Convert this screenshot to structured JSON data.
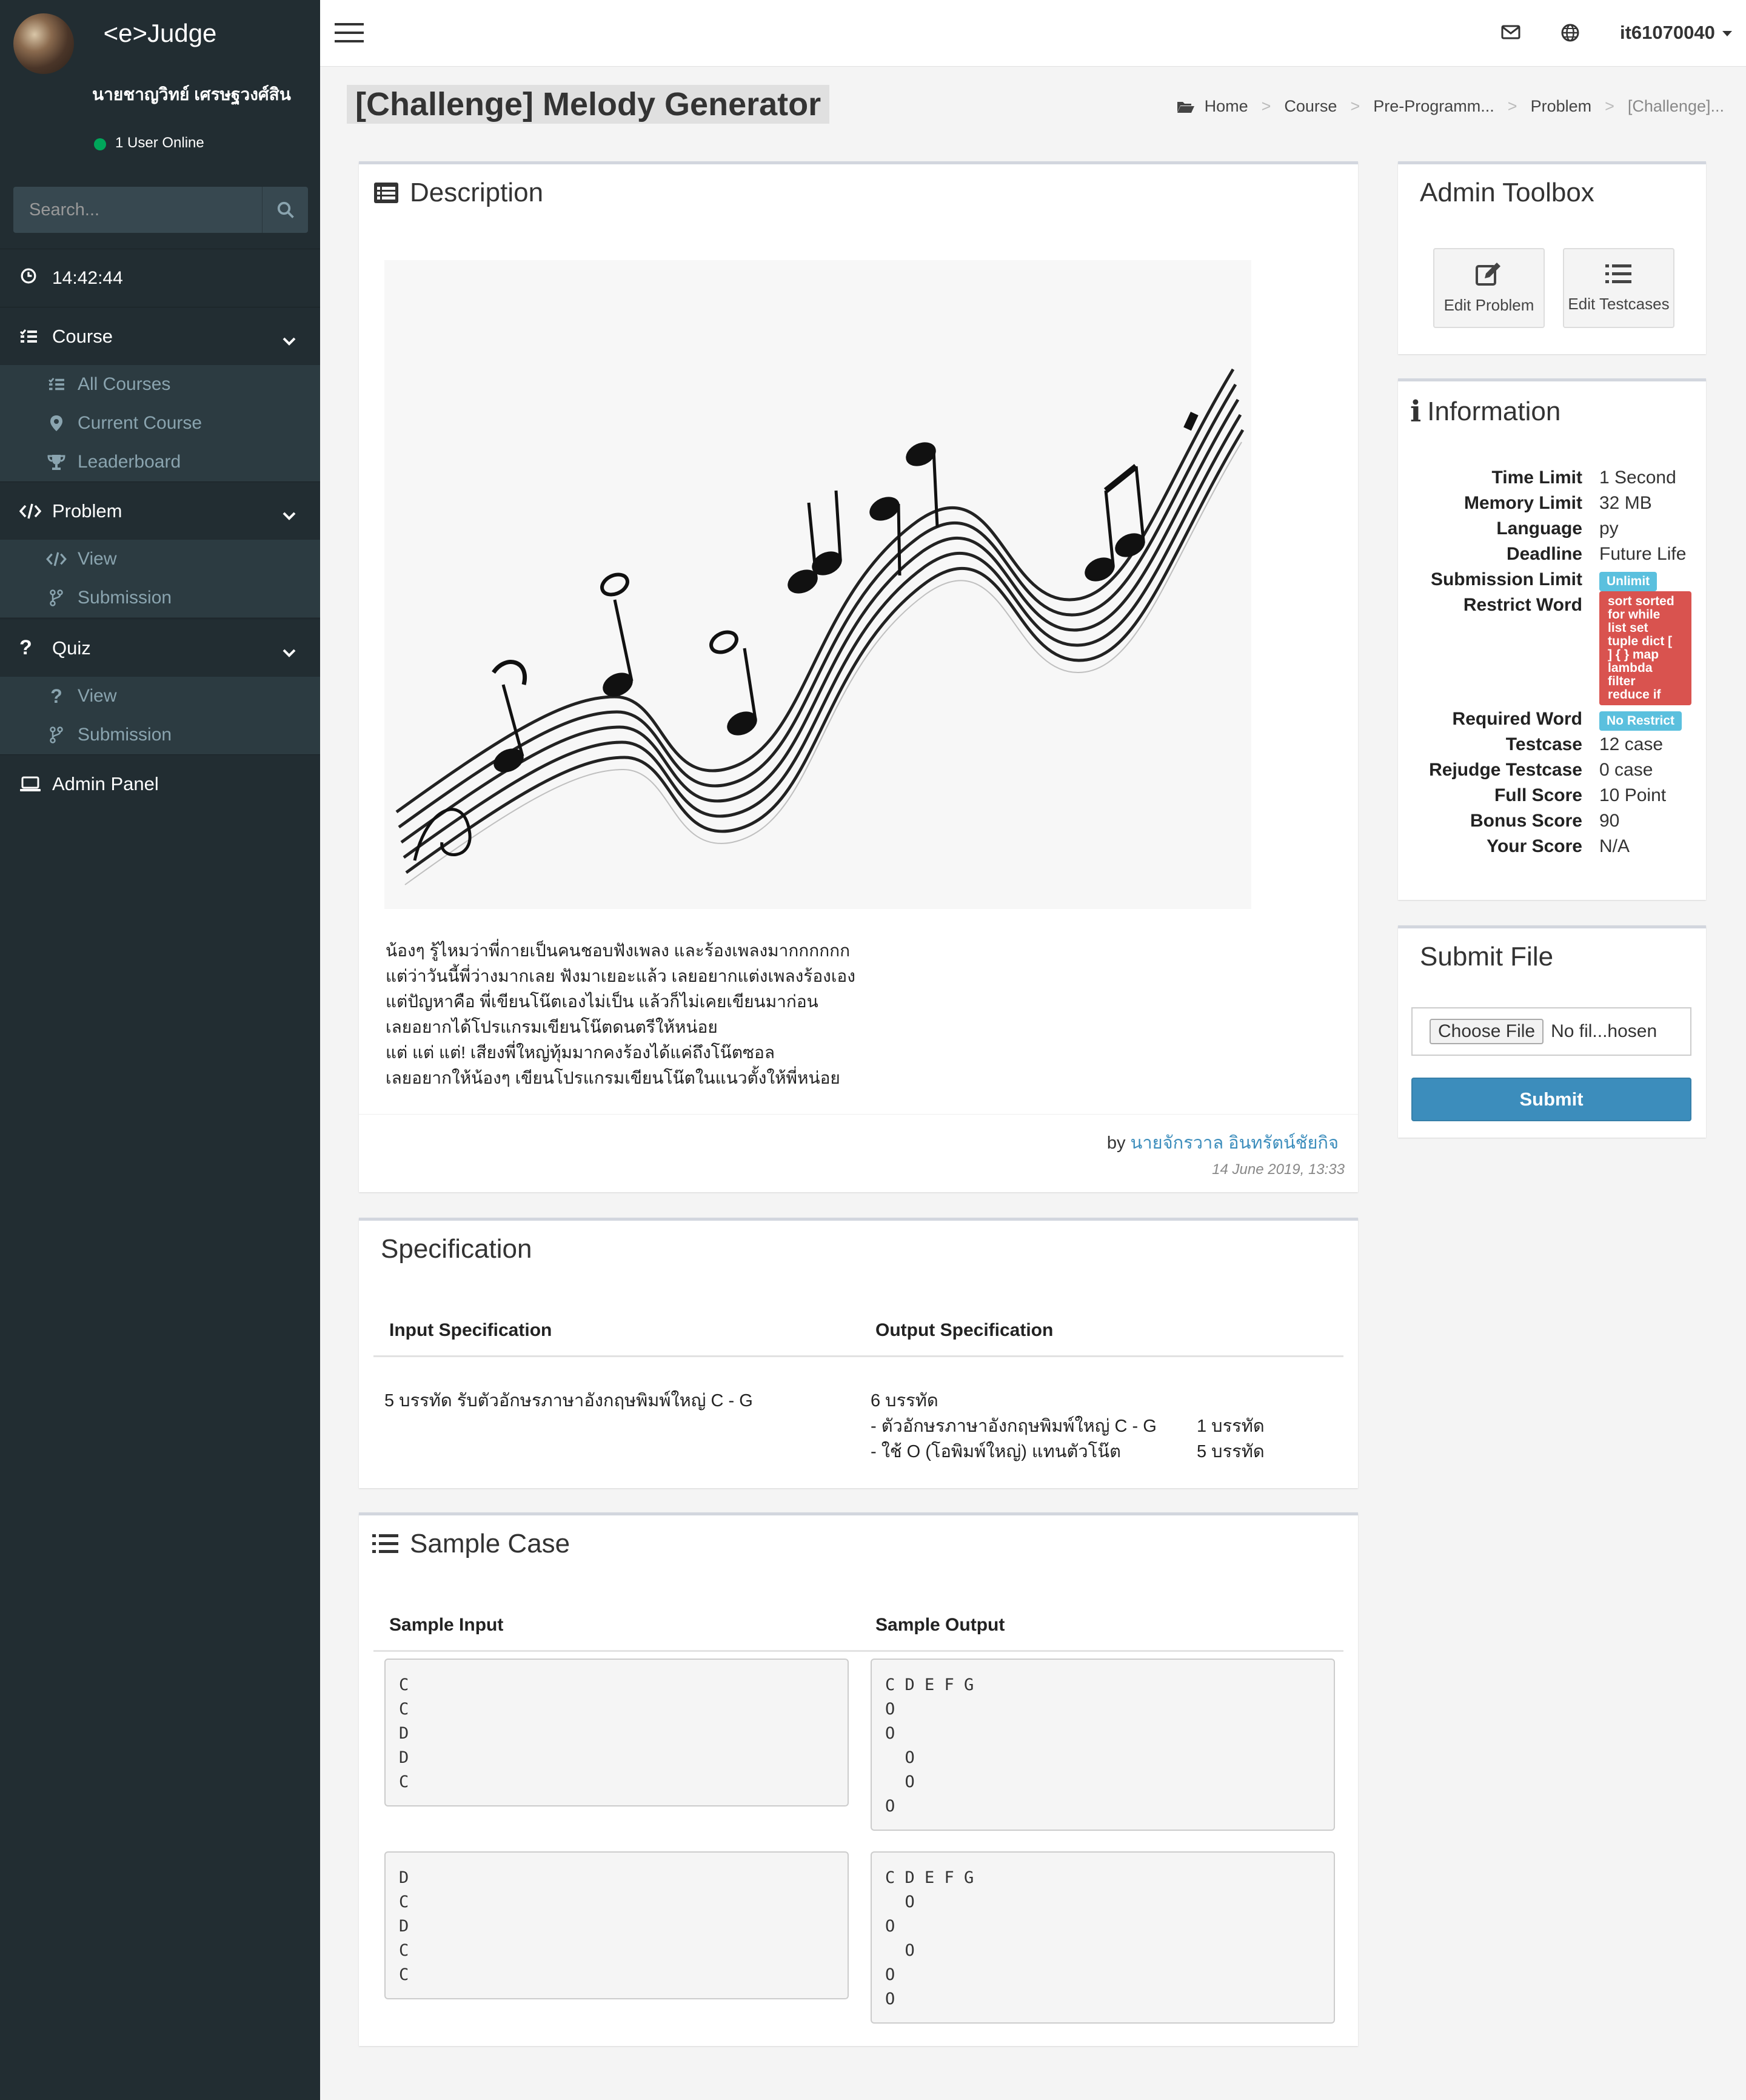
{
  "app": {
    "logo": "<e>Judge"
  },
  "user": {
    "name": "นายชาญวิทย์ เศรษฐวงศ์สิน",
    "status": "1 User Online",
    "username": "it61070040"
  },
  "search": {
    "placeholder": "Search..."
  },
  "clock": {
    "time": "14:42:44"
  },
  "menu": {
    "course": {
      "label": "Course",
      "items": [
        "All Courses",
        "Current Course",
        "Leaderboard"
      ]
    },
    "problem": {
      "label": "Problem",
      "items": [
        "View",
        "Submission"
      ]
    },
    "quiz": {
      "label": "Quiz",
      "items": [
        "View",
        "Submission"
      ]
    },
    "admin": {
      "label": "Admin Panel"
    }
  },
  "page": {
    "title": "[Challenge] Melody Generator",
    "breadcrumb": [
      "Home",
      "Course",
      "Pre-Programm...",
      "Problem",
      "[Challenge]..."
    ]
  },
  "description": {
    "title": "Description",
    "text": "น้องๆ รู้ไหมว่าพี่กายเป็นคนชอบฟังเพลง และร้องเพลงมากกกกกก\nแต่ว่าวันนี้พี่ว่างมากเลย ฟังมาเยอะแล้ว เลยอยากแต่งเพลงร้องเอง\nแต่ปัญหาคือ พี่เขียนโน๊ตเองไม่เป็น แล้วก็ไม่เคยเขียนมาก่อน\nเลยอยากได้โปรแกรมเขียนโน๊ตดนตรีให้หน่อย\nแต่ แต่ แต่! เสียงพี่ใหญ่ทุ้มมากคงร้องได้แค่ถึงโน๊ตซอล\nเลยอยากให้น้องๆ เขียนโปรแกรมเขียนโน๊ตในแนวตั้งให้พี่หน่อย",
    "by": "by",
    "author": "นายจักรวาล อินทรัตน์ชัยกิจ",
    "date": "14 June 2019, 13:33"
  },
  "specification": {
    "title": "Specification",
    "input_header": "Input Specification",
    "output_header": "Output Specification",
    "input": "5 บรรทัด รับตัวอักษรภาษาอังกฤษพิมพ์ใหญ่ C - G",
    "output_line1": "6 บรรทัด",
    "output_line2": "- ตัวอักษรภาษาอังกฤษพิมพ์ใหญ่ C - G",
    "output_line2_count": "1 บรรทัด",
    "output_line3": "- ใช้ O (โอพิมพ์ใหญ่) แทนตัวโน๊ต",
    "output_line3_count": "5 บรรทัด"
  },
  "sample": {
    "title": "Sample Case",
    "input_header": "Sample Input",
    "output_header": "Sample Output",
    "cases": [
      {
        "input": "C\nC\nD\nD\nC",
        "output": "C D E F G\nO\nO\n  O\n  O\nO"
      },
      {
        "input": "D\nC\nD\nC\nC",
        "output": "C D E F G\n  O\nO\n  O\nO\nO"
      }
    ]
  },
  "toolbox": {
    "title": "Admin Toolbox",
    "edit_problem": "Edit Problem",
    "edit_testcases": "Edit Testcases"
  },
  "information": {
    "title": "Information",
    "time_limit_k": "Time Limit",
    "time_limit_v": "1 Second",
    "memory_limit_k": "Memory Limit",
    "memory_limit_v": "32 MB",
    "language_k": "Language",
    "language_v": "py",
    "deadline_k": "Deadline",
    "deadline_v": "Future Life",
    "submission_limit_k": "Submission Limit",
    "submission_limit_v": "Unlimit",
    "restrict_word_k": "Restrict Word",
    "restrict_word_v": "sort sorted\nfor while\nlist set\ntuple dict [\n] { } map\nlambda\nfilter\nreduce if",
    "required_word_k": "Required Word",
    "required_word_v": "No Restrict",
    "testcase_k": "Testcase",
    "testcase_v": "12 case",
    "rejudge_k": "Rejudge Testcase",
    "rejudge_v": "0 case",
    "full_score_k": "Full Score",
    "full_score_v": "10 Point",
    "bonus_score_k": "Bonus Score",
    "bonus_score_v": "90",
    "your_score_k": "Your Score",
    "your_score_v": "N/A"
  },
  "submit": {
    "title": "Submit File",
    "choose": "Choose File",
    "no_file": "No fil...hosen",
    "button": "Submit"
  },
  "colors": {
    "sidebar": "#222d32",
    "accent": "#3c8dbc",
    "danger": "#d9534f",
    "info": "#5bc0de",
    "online": "#00a65a"
  }
}
